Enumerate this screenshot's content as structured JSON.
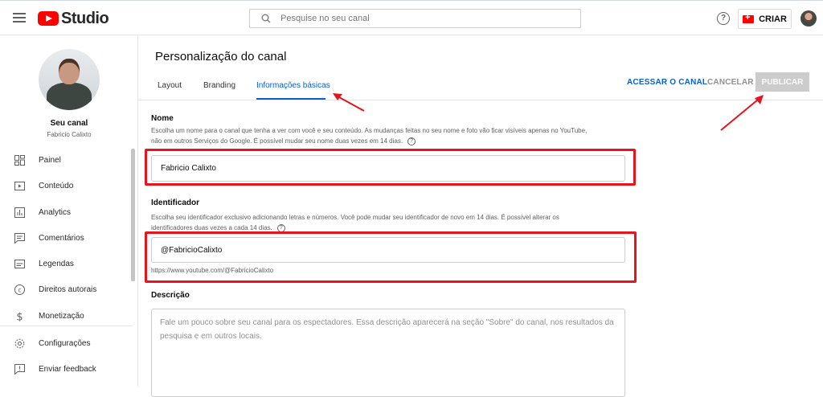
{
  "header": {
    "logo_text": "Studio",
    "search_placeholder": "Pesquise no seu canal",
    "help_glyph": "?",
    "create_label": "CRIAR"
  },
  "sidebar": {
    "channel_title": "Seu canal",
    "channel_name": "Fabricio Calixto",
    "items": [
      {
        "label": "Painel",
        "icon": "dashboard-icon"
      },
      {
        "label": "Conteúdo",
        "icon": "content-icon"
      },
      {
        "label": "Analytics",
        "icon": "analytics-icon"
      },
      {
        "label": "Comentários",
        "icon": "comments-icon"
      },
      {
        "label": "Legendas",
        "icon": "subtitles-icon"
      },
      {
        "label": "Direitos autorais",
        "icon": "copyright-icon"
      },
      {
        "label": "Monetização",
        "icon": "monetization-icon"
      },
      {
        "label": "Configurações",
        "icon": "settings-icon"
      },
      {
        "label": "Enviar feedback",
        "icon": "feedback-icon"
      }
    ]
  },
  "page": {
    "title": "Personalização do canal",
    "tabs": [
      {
        "label": "Layout"
      },
      {
        "label": "Branding"
      },
      {
        "label": "Informações básicas",
        "active": true
      }
    ],
    "actions": {
      "view_channel": "ACESSAR O CANAL",
      "cancel": "CANCELAR",
      "publish": "PUBLICAR"
    }
  },
  "form": {
    "name": {
      "title": "Nome",
      "description_line1": "Escolha um nome para o canal que tenha a ver com você e seu conteúdo. As mudanças feitas no seu nome e foto vão ficar visíveis apenas no YouTube,",
      "description_line2": "não em outros Serviços do Google. É possível mudar seu nome duas vezes em 14 dias.",
      "value": "Fabricio Calixto"
    },
    "handle": {
      "title": "Identificador",
      "description_line1": "Escolha seu identificador exclusivo adicionando letras e números. Você pode mudar seu identificador de novo em 14 dias. É possível alterar os",
      "description_line2": "identificadores duas vezes a cada 14 dias.",
      "value": "@FabricioCalixto",
      "url": "https://www.youtube.com/@FabricioCalixto"
    },
    "description": {
      "title": "Descrição",
      "placeholder_line1": "Fale um pouco sobre seu canal para os espectadores. Essa descrição aparecerá na seção \"Sobre\" do canal, nos resultados da",
      "placeholder_line2": "pesquisa e em outros locais."
    }
  },
  "annotations": {
    "highlight_color": "#e8141c"
  }
}
